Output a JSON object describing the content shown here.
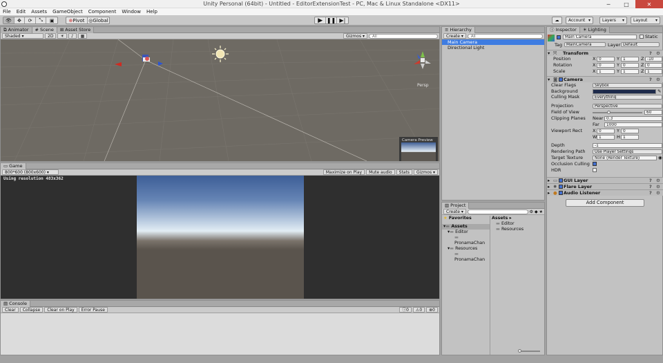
{
  "window": {
    "title": "Unity Personal (64bit) - Untitled - EditorExtensionTest - PC, Mac & Linux Standalone <DX11>"
  },
  "menu": [
    "File",
    "Edit",
    "Assets",
    "GameObject",
    "Component",
    "Window",
    "Help"
  ],
  "toolbar": {
    "pivot_label": "Pivot",
    "global_label": "Global",
    "account_label": "Account",
    "layers_label": "Layers",
    "layout_label": "Layout"
  },
  "scene": {
    "tabs": [
      "Animator",
      "Scene",
      "Asset Store"
    ],
    "shading": "Shaded",
    "mode_2d": "2D",
    "gizmos": "Gizmos",
    "search_placeholder": "All",
    "persp_label": "Persp",
    "camera_preview_title": "Camera Preview"
  },
  "game": {
    "tab": "Game",
    "resolution": "800*600 (800x600)",
    "buttons": [
      "Maximize on Play",
      "Mute audio",
      "Stats",
      "Gizmos"
    ],
    "using_resolution": "Using resolution 483x362"
  },
  "console": {
    "tab": "Console",
    "buttons": [
      "Clear",
      "Collapse",
      "Clear on Play",
      "Error Pause"
    ],
    "counts": [
      "0",
      "0",
      "0"
    ]
  },
  "hierarchy": {
    "tab": "Hierarchy",
    "create": "Create",
    "search_placeholder": "All",
    "items": [
      "Main Camera",
      "Directional Light"
    ]
  },
  "project": {
    "tab": "Project",
    "create": "Create",
    "favorites": "Favorites",
    "tree": [
      "Assets",
      "Editor",
      "PronamaChan",
      "Resources",
      "PronamaChan"
    ],
    "assets_header": "Assets",
    "assets_items": [
      "Editor",
      "Resources"
    ]
  },
  "inspector": {
    "tabs": [
      "Inspector",
      "Lighting"
    ],
    "object_name": "Main Camera",
    "static_label": "Static",
    "tag_label": "Tag",
    "tag_value": "MainCamera",
    "layer_label": "Layer",
    "layer_value": "Default",
    "transform": {
      "title": "Transform",
      "position_label": "Position",
      "position": [
        "0",
        "1",
        "-10"
      ],
      "rotation_label": "Rotation",
      "rotation": [
        "0",
        "0",
        "0"
      ],
      "scale_label": "Scale",
      "scale": [
        "1",
        "1",
        "1"
      ]
    },
    "camera": {
      "title": "Camera",
      "clear_flags_label": "Clear Flags",
      "clear_flags": "Skybox",
      "background_label": "Background",
      "background_color": "#1d2a4a",
      "culling_mask_label": "Culling Mask",
      "culling_mask": "Everything",
      "projection_label": "Projection",
      "projection": "Perspective",
      "fov_label": "Field of View",
      "fov": "60",
      "fov_fraction": 0.33,
      "clipping_label": "Clipping Planes",
      "near_label": "Near",
      "near": "0.3",
      "far_label": "Far",
      "far": "1000",
      "viewport_label": "Viewport Rect",
      "vx": "0",
      "vy": "0",
      "vw": "1",
      "vh": "1",
      "depth_label": "Depth",
      "depth": "-1",
      "rendering_path_label": "Rendering Path",
      "rendering_path": "Use Player Settings",
      "target_texture_label": "Target Texture",
      "target_texture": "None (Render Texture)",
      "occlusion_label": "Occlusion Culling",
      "hdr_label": "HDR"
    },
    "components": [
      "GUI Layer",
      "Flare Layer",
      "Audio Listener"
    ],
    "add_component": "Add Component"
  },
  "colors": {
    "scene_bg": "#6e6a63",
    "selection": "#3e7ce1",
    "game_bg": "#2f2f2f"
  }
}
